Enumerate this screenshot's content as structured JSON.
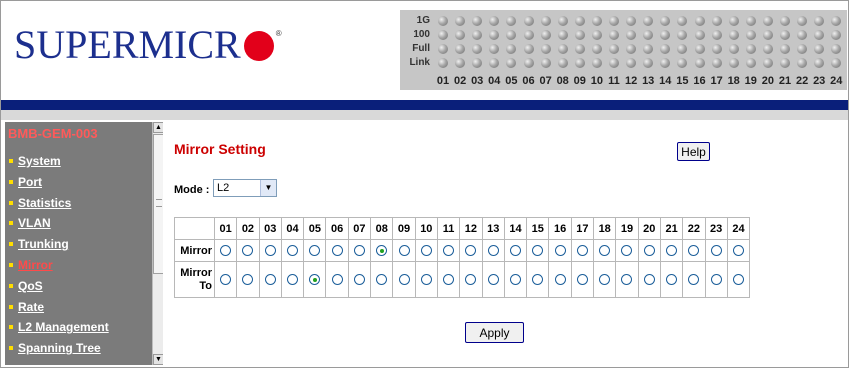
{
  "header": {
    "brand": "SUPERMICR",
    "registered": "®",
    "led_rows": [
      "1G",
      "100",
      "Full",
      "Link"
    ],
    "ports": [
      "01",
      "02",
      "03",
      "04",
      "05",
      "06",
      "07",
      "08",
      "09",
      "10",
      "11",
      "12",
      "13",
      "14",
      "15",
      "16",
      "17",
      "18",
      "19",
      "20",
      "21",
      "22",
      "23",
      "24"
    ]
  },
  "sidebar": {
    "title": "BMB-GEM-003",
    "items": [
      {
        "label": "System",
        "active": false
      },
      {
        "label": "Port",
        "active": false
      },
      {
        "label": "Statistics",
        "active": false
      },
      {
        "label": "VLAN",
        "active": false
      },
      {
        "label": "Trunking",
        "active": false
      },
      {
        "label": "Mirror",
        "active": true
      },
      {
        "label": "QoS",
        "active": false
      },
      {
        "label": "Rate",
        "active": false
      },
      {
        "label": "L2 Management",
        "active": false
      },
      {
        "label": "Spanning Tree",
        "active": false
      }
    ]
  },
  "main": {
    "title": "Mirror Setting",
    "help_label": "Help",
    "mode_label": "Mode :",
    "mode_value": "L2",
    "table": {
      "ports": [
        "01",
        "02",
        "03",
        "04",
        "05",
        "06",
        "07",
        "08",
        "09",
        "10",
        "11",
        "12",
        "13",
        "14",
        "15",
        "16",
        "17",
        "18",
        "19",
        "20",
        "21",
        "22",
        "23",
        "24"
      ],
      "mirror_label": "Mirror",
      "mirror_to_label_1": "Mirror",
      "mirror_to_label_2": "To",
      "mirror_selected": "08",
      "mirror_to_selected": "05"
    },
    "apply_label": "Apply"
  },
  "colors": {
    "brand_blue": "#1c2f8e",
    "brand_red": "#e2001a",
    "title_red": "#cc0000",
    "nav_bg": "#7b7b7b",
    "nav_active": "#ff4a4a",
    "bar_blue": "#0a1f7a"
  }
}
